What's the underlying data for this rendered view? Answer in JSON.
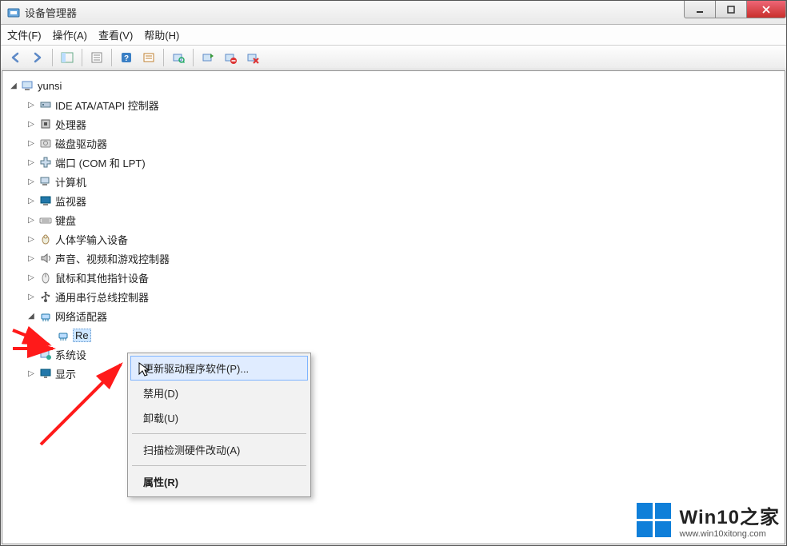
{
  "window": {
    "title": "设备管理器"
  },
  "menubar": {
    "file": "文件(F)",
    "action": "操作(A)",
    "view": "查看(V)",
    "help": "帮助(H)"
  },
  "toolbar_icons": {
    "back": "back-icon",
    "forward": "forward-icon",
    "up": "show-hide-tree-icon",
    "properties": "properties-icon",
    "help": "help-icon",
    "details": "details-icon",
    "scan": "scan-hardware-icon",
    "update": "update-driver-icon",
    "disable": "disable-device-icon",
    "uninstall": "uninstall-device-icon"
  },
  "tree": {
    "root": "yunsi",
    "nodes": [
      {
        "label": "IDE ATA/ATAPI 控制器",
        "icon": "controller-icon"
      },
      {
        "label": "处理器",
        "icon": "cpu-icon"
      },
      {
        "label": "磁盘驱动器",
        "icon": "disk-icon"
      },
      {
        "label": "端口 (COM 和 LPT)",
        "icon": "port-icon"
      },
      {
        "label": "计算机",
        "icon": "computer-icon"
      },
      {
        "label": "监视器",
        "icon": "monitor-icon"
      },
      {
        "label": "键盘",
        "icon": "keyboard-icon"
      },
      {
        "label": "人体学输入设备",
        "icon": "hid-icon"
      },
      {
        "label": "声音、视频和游戏控制器",
        "icon": "sound-icon"
      },
      {
        "label": "鼠标和其他指针设备",
        "icon": "mouse-icon"
      },
      {
        "label": "通用串行总线控制器",
        "icon": "usb-icon"
      }
    ],
    "network_adapter": {
      "label": "网络适配器",
      "child_partial": "Re"
    },
    "after_nodes": [
      {
        "label": "系统设",
        "icon": "system-icon"
      },
      {
        "label": "显示",
        "icon": "display-icon"
      }
    ]
  },
  "context_menu": {
    "items": [
      {
        "key": "update",
        "label": "更新驱动程序软件(P)...",
        "highlight": true
      },
      {
        "key": "disable",
        "label": "禁用(D)"
      },
      {
        "key": "uninstall",
        "label": "卸载(U)"
      }
    ],
    "sep1": true,
    "scan": {
      "label": "扫描检测硬件改动(A)"
    },
    "sep2": true,
    "props": {
      "label": "属性(R)"
    }
  },
  "watermark": {
    "brand": "Win10之家",
    "url": "www.win10xitong.com"
  },
  "colors": {
    "accent": "#0f7fd9",
    "close": "#c9302c",
    "highlight_bg": "#e0ecff"
  }
}
